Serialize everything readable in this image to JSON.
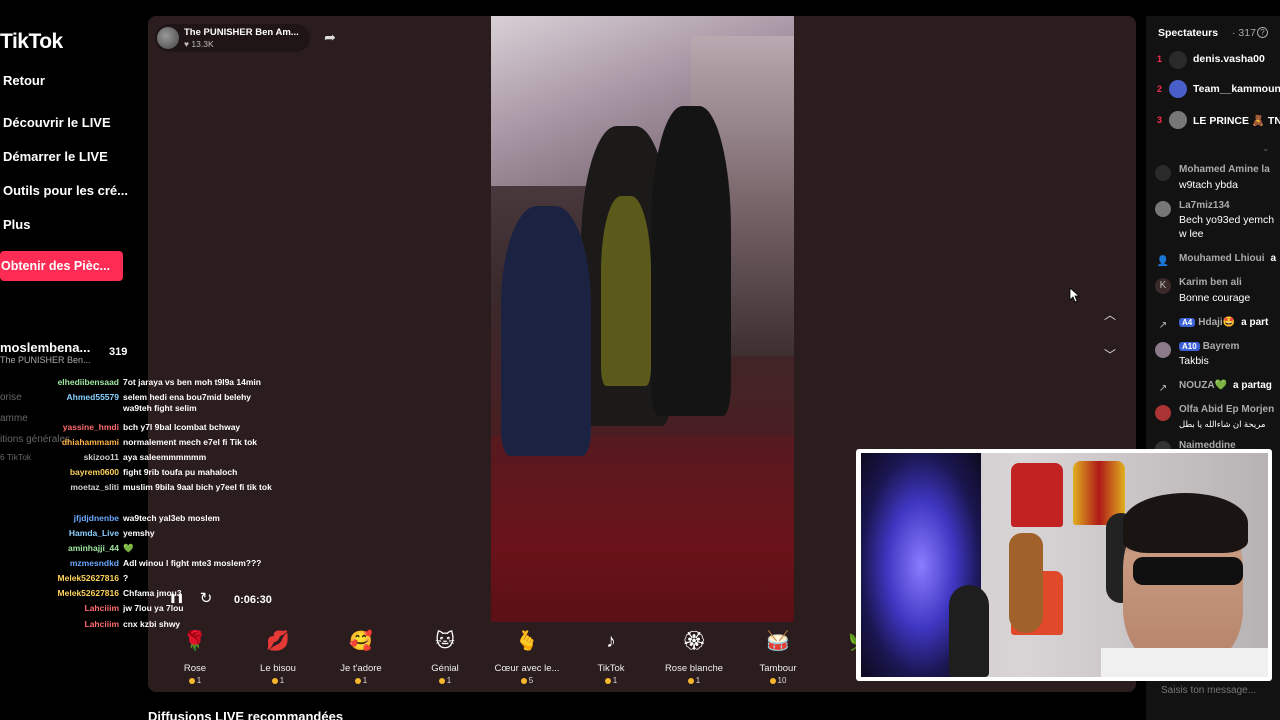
{
  "sidebar": {
    "logo": "TikTok",
    "items": [
      {
        "label": "Retour"
      },
      {
        "label": "Découvrir le LIVE"
      },
      {
        "label": "Démarrer le LIVE"
      },
      {
        "label": "Outils pour les cré..."
      },
      {
        "label": "Plus"
      }
    ],
    "coins_button": "Obtenir des Pièc...",
    "host": {
      "name": "moslembena...",
      "sub": "The PUNISHER Ben...",
      "count": "319"
    },
    "faded": [
      "orise",
      "amme",
      "itions générales",
      "6 TikTok"
    ]
  },
  "stream": {
    "host_title": "The PUNISHER Ben Am...",
    "likes": "13.3K",
    "timer": "0:06:30"
  },
  "overlay_chat": [
    {
      "user": "elhediibensaad",
      "msg": "7ot jaraya vs ben moh t9l9a 14min",
      "color": "#9fe6a0"
    },
    {
      "user": "Ahmed55579",
      "msg": "selem hedi ena bou7mid belehy wa9teh fight selim",
      "color": "#8ad1ff"
    },
    {
      "user": "yassine_hmdi",
      "msg": "bch y7l 9bal lcombat bchway",
      "color": "#ff6b6b"
    },
    {
      "user": "dhiahammami",
      "msg": "normalement mech e7el fi Tik tok",
      "color": "#ffb347"
    },
    {
      "user": "skizoo11",
      "msg": "aya saleemmmmmm",
      "color": "#cfcfcf"
    },
    {
      "user": "bayrem0600",
      "msg": "fight 9rib toufa pu mahaloch",
      "color": "#ffd35c"
    },
    {
      "user": "moetaz_sliti",
      "msg": "muslim 9bila 9aal bich y7eel fi tik tok",
      "color": "#cfcfcf"
    },
    {
      "user": "jfjdjdnenbe",
      "msg": "wa9tech yal3eb moslem",
      "color": "#6aa8ff"
    },
    {
      "user": "Hamda_Live",
      "msg": "yemshy",
      "color": "#8ad1ff"
    },
    {
      "user": "aminhajji_44",
      "msg": "💚",
      "color": "#9fe6a0"
    },
    {
      "user": "mzmesndkd",
      "msg": "Adl winou l fight mte3 moslem???",
      "color": "#6aa8ff"
    },
    {
      "user": "Melek52627816",
      "msg": "?",
      "color": "#ffd35c"
    },
    {
      "user": "Melek52627816",
      "msg": "Chfama jmou3",
      "color": "#ffd35c"
    },
    {
      "user": "Lahciiim",
      "msg": "jw 7lou ya 7lou",
      "color": "#ff6b6b"
    },
    {
      "user": "Lahciiim",
      "msg": "cnx kzbi shwy",
      "color": "#ff6b6b"
    }
  ],
  "gifts": [
    {
      "name": "Rose",
      "price": "1",
      "icon": "🌹"
    },
    {
      "name": "Le bisou",
      "price": "1",
      "icon": "💋"
    },
    {
      "name": "Je t'adore",
      "price": "1",
      "icon": "🥰"
    },
    {
      "name": "Génial",
      "price": "1",
      "icon": "🐱"
    },
    {
      "name": "Cœur avec le...",
      "price": "5",
      "icon": "🫰"
    },
    {
      "name": "TikTok",
      "price": "1",
      "icon": "♪"
    },
    {
      "name": "Rose blanche",
      "price": "1",
      "icon": "🏵"
    },
    {
      "name": "Tambour",
      "price": "10",
      "icon": "🥁"
    },
    {
      "name": "Pi",
      "price": "",
      "icon": "🌿"
    }
  ],
  "recommended_title": "Diffusions LIVE recommandées",
  "right_panel": {
    "viewers_label": "Spectateurs",
    "viewers_count": "· 317",
    "ranking": [
      {
        "rank": "1",
        "name": "denis.vasha00"
      },
      {
        "rank": "2",
        "name": "Team__kammoun"
      },
      {
        "rank": "3",
        "name": "LE PRINCE 🧸 TN"
      }
    ],
    "comments": [
      {
        "user": "Mohamed Amine la",
        "msg": "w9tach ybda",
        "icon": ""
      },
      {
        "user": "La7miz134",
        "msg": "Bech yo93ed yemch",
        "msg2": "w lee",
        "icon": ""
      },
      {
        "user": "Mouhamed Lhioui",
        "msg": "a",
        "icon": "👤"
      },
      {
        "user": "Karim ben ali",
        "msg": "Bonne courage",
        "icon": "K"
      },
      {
        "user": "Hdaji🤩",
        "badge": "A4",
        "msg": "a part",
        "icon": "↗"
      },
      {
        "user": "Bayrem",
        "badge": "A10",
        "msg": "Takbis",
        "icon": ""
      },
      {
        "user": "NOUZA💚",
        "msg": "a partag",
        "icon": "↗"
      },
      {
        "user": "Olfa Abid Ep Morjen",
        "msg": "مريحة ان شاءالله يا بطل",
        "icon": ""
      },
      {
        "user": "Naimeddine",
        "msg": "",
        "icon": ""
      }
    ],
    "input_placeholder": "Saisis ton message..."
  }
}
